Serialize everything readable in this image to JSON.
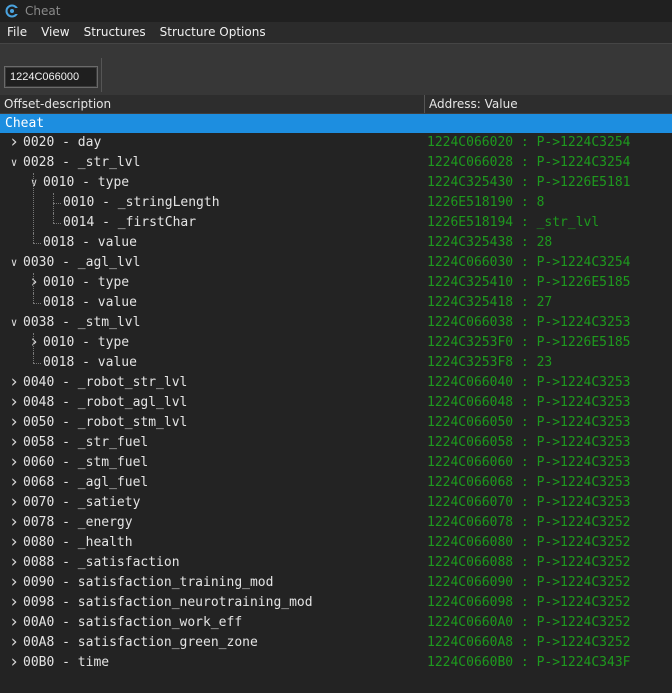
{
  "window": {
    "title": "Cheat"
  },
  "menu": {
    "items": [
      "File",
      "View",
      "Structures",
      "Structure Options"
    ]
  },
  "toolbar": {
    "address_value": "1224C066000"
  },
  "columns": {
    "left": "Offset-description",
    "right": "Address: Value"
  },
  "tree": {
    "root": "Cheat",
    "rows": [
      {
        "label": "0020 - day",
        "value": "1224C066020 : P->1224C3254",
        "exp": "collapsed",
        "depth": 0
      },
      {
        "label": "0028 - _str_lvl",
        "value": "1224C066028 : P->1224C3254",
        "exp": "expanded",
        "depth": 0
      },
      {
        "label": "0010 - type",
        "value": "1224C325430 : P->1226E5181",
        "exp": "expanded",
        "depth": 1
      },
      {
        "label": "0010 - _stringLength",
        "value": "1226E518190 : 8",
        "exp": "none",
        "depth": 2
      },
      {
        "label": "0014 - _firstChar",
        "value": "1226E518194 : _str_lvl",
        "exp": "none",
        "depth": 2
      },
      {
        "label": "0018 - value",
        "value": "1224C325438 : 28",
        "exp": "none",
        "depth": 1
      },
      {
        "label": "0030 - _agl_lvl",
        "value": "1224C066030 : P->1224C3254",
        "exp": "expanded",
        "depth": 0
      },
      {
        "label": "0010 - type",
        "value": "1224C325410 : P->1226E5185",
        "exp": "collapsed",
        "depth": 1
      },
      {
        "label": "0018 - value",
        "value": "1224C325418 : 27",
        "exp": "none",
        "depth": 1
      },
      {
        "label": "0038 - _stm_lvl",
        "value": "1224C066038 : P->1224C3253",
        "exp": "expanded",
        "depth": 0
      },
      {
        "label": "0010 - type",
        "value": "1224C3253F0 : P->1226E5185",
        "exp": "collapsed",
        "depth": 1
      },
      {
        "label": "0018 - value",
        "value": "1224C3253F8 : 23",
        "exp": "none",
        "depth": 1
      },
      {
        "label": "0040 - _robot_str_lvl",
        "value": "1224C066040 : P->1224C3253",
        "exp": "collapsed",
        "depth": 0
      },
      {
        "label": "0048 - _robot_agl_lvl",
        "value": "1224C066048 : P->1224C3253",
        "exp": "collapsed",
        "depth": 0
      },
      {
        "label": "0050 - _robot_stm_lvl",
        "value": "1224C066050 : P->1224C3253",
        "exp": "collapsed",
        "depth": 0
      },
      {
        "label": "0058 - _str_fuel",
        "value": "1224C066058 : P->1224C3253",
        "exp": "collapsed",
        "depth": 0
      },
      {
        "label": "0060 - _stm_fuel",
        "value": "1224C066060 : P->1224C3253",
        "exp": "collapsed",
        "depth": 0
      },
      {
        "label": "0068 - _agl_fuel",
        "value": "1224C066068 : P->1224C3253",
        "exp": "collapsed",
        "depth": 0
      },
      {
        "label": "0070 - _satiety",
        "value": "1224C066070 : P->1224C3253",
        "exp": "collapsed",
        "depth": 0
      },
      {
        "label": "0078 - _energy",
        "value": "1224C066078 : P->1224C3252",
        "exp": "collapsed",
        "depth": 0
      },
      {
        "label": "0080 - _health",
        "value": "1224C066080 : P->1224C3252",
        "exp": "collapsed",
        "depth": 0
      },
      {
        "label": "0088 - _satisfaction",
        "value": "1224C066088 : P->1224C3252",
        "exp": "collapsed",
        "depth": 0
      },
      {
        "label": "0090 - satisfaction_training_mod",
        "value": "1224C066090 : P->1224C3252",
        "exp": "collapsed",
        "depth": 0
      },
      {
        "label": "0098 - satisfaction_neurotraining_mod",
        "value": "1224C066098 : P->1224C3252",
        "exp": "collapsed",
        "depth": 0
      },
      {
        "label": "00A0 - satisfaction_work_eff",
        "value": "1224C0660A0 : P->1224C3252",
        "exp": "collapsed",
        "depth": 0
      },
      {
        "label": "00A8 - satisfaction_green_zone",
        "value": "1224C0660A8 : P->1224C3252",
        "exp": "collapsed",
        "depth": 0
      },
      {
        "label": "00B0 - time",
        "value": "1224C0660B0 : P->1224C343F",
        "exp": "collapsed",
        "depth": 0
      }
    ]
  },
  "colors": {
    "selection": "#1d8ee0",
    "value_text": "#1e9a1e",
    "background": "#232323"
  },
  "icons": {
    "app": "cheat-engine-icon",
    "expander_collapsed": "chevron-right-icon",
    "expander_expanded": "chevron-down-icon"
  }
}
